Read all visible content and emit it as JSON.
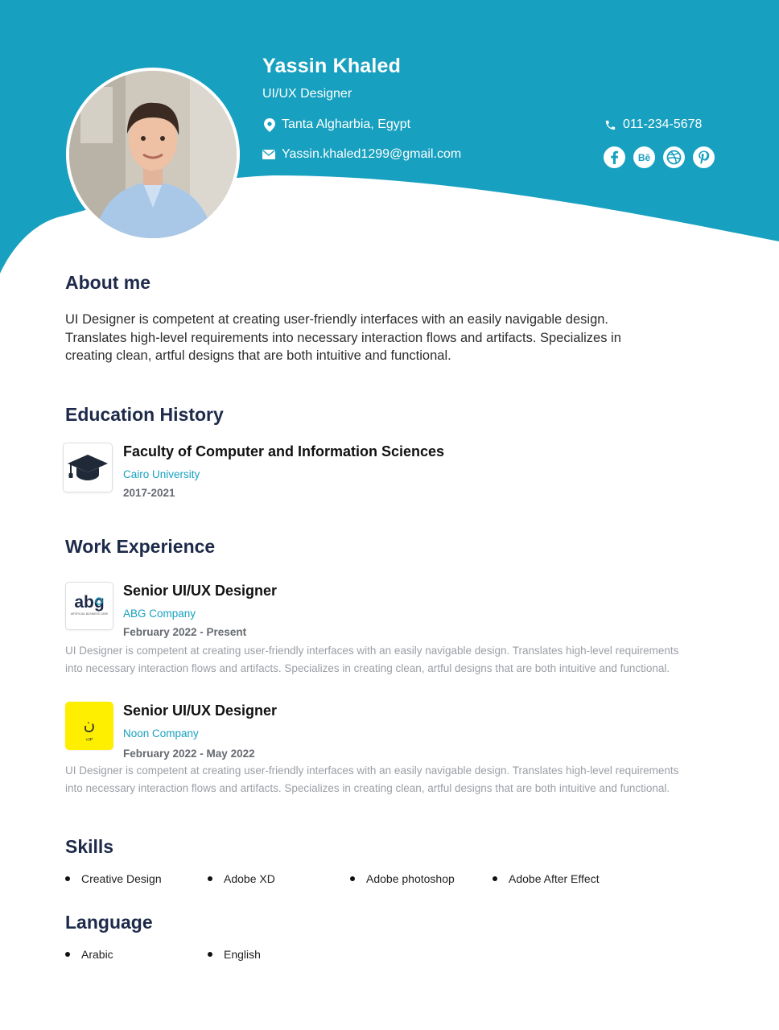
{
  "header": {
    "name": "Yassin Khaled",
    "role": "UI/UX Designer",
    "location": "Tanta Algharbia, Egypt",
    "email": "Yassin.khaled1299@gmail.com",
    "phone": "011-234-5678",
    "social_icons": [
      "facebook-icon",
      "behance-icon",
      "dribbble-icon",
      "pinterest-icon"
    ],
    "accent_color": "#17a0bf"
  },
  "about": {
    "title": "About me",
    "lines": [
      "UI Designer is competent at creating user-friendly interfaces with an easily navigable design.",
      "Translates high-level requirements into necessary interaction flows and artifacts. Specializes in",
      "creating clean, artful designs that are both intuitive and functional."
    ]
  },
  "education": {
    "title": "Education History",
    "items": [
      {
        "degree": "Faculty of Computer and Information Sciences",
        "institution": "Cairo University",
        "years": "2017-2021",
        "logo_icon": "graduation-cap-icon"
      }
    ]
  },
  "work": {
    "title": "Work Experience",
    "items": [
      {
        "title": "Senior UI/UX Designer",
        "company": "ABG Company",
        "dates": "February 2022 - Present",
        "logo_text": "abg",
        "logo_subtext": "ARTIFICIAL BUSINESS CARE",
        "desc_lines": [
          "UI Designer is competent at creating user-friendly interfaces with an easily navigable design. Translates high-level requirements",
          "into necessary interaction flows and artifacts. Specializes in creating clean, artful designs that are both intuitive and functional."
        ]
      },
      {
        "title": "Senior UI/UX Designer",
        "company": "Noon Company",
        "dates": "February 2022 - May 2022",
        "logo_text": "ن",
        "logo_subtext": "نون",
        "logo_color": "#feee00",
        "desc_lines": [
          "UI Designer is competent at creating user-friendly interfaces with an easily navigable design. Translates high-level requirements",
          "into necessary interaction flows and artifacts. Specializes in creating clean, artful designs that are both intuitive and functional."
        ]
      }
    ]
  },
  "skills": {
    "title": "Skills",
    "items": [
      "Creative Design",
      "Adobe XD",
      "Adobe photoshop",
      "Adobe After Effect"
    ]
  },
  "language": {
    "title": "Language",
    "items": [
      "Arabic",
      "English"
    ]
  }
}
